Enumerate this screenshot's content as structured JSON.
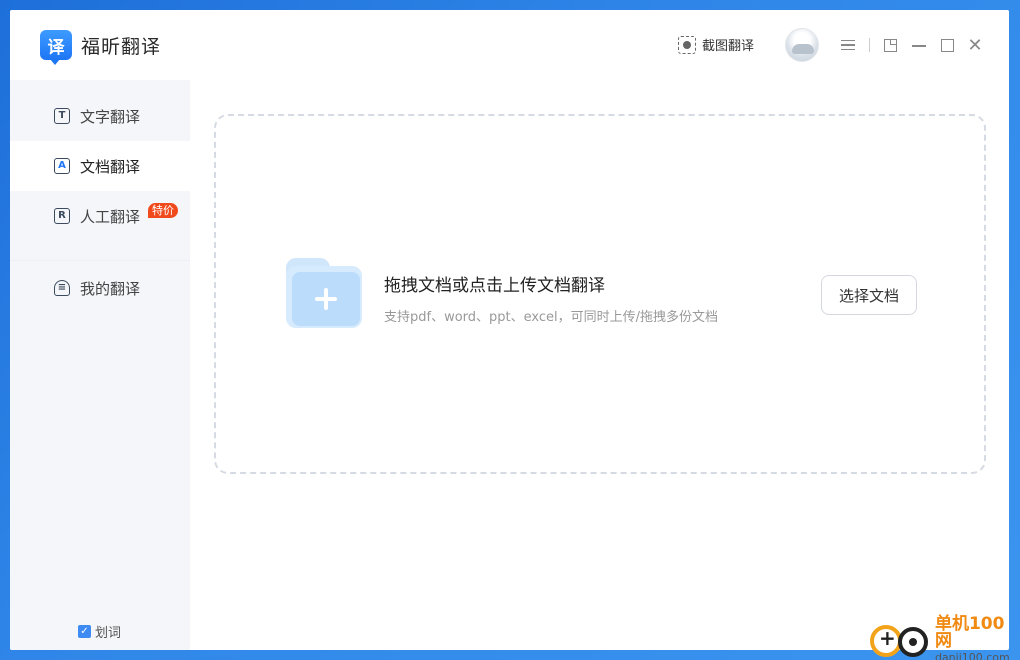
{
  "app": {
    "logo_glyph": "译",
    "name": "福昕翻译"
  },
  "titlebar": {
    "screenshot_translate": "截图翻译",
    "close_glyph": "✕"
  },
  "sidebar": {
    "items": [
      {
        "label": "文字翻译",
        "icon": "text-translate-icon",
        "icon_glyph": "T"
      },
      {
        "label": "文档翻译",
        "icon": "document-translate-icon",
        "icon_glyph": "A"
      },
      {
        "label": "人工翻译",
        "icon": "human-translate-icon",
        "icon_glyph": "R",
        "badge": "特价"
      },
      {
        "label": "我的翻译",
        "icon": "my-translations-icon",
        "icon_glyph": "≡"
      }
    ],
    "huaci": {
      "label": "划词",
      "checked": true,
      "check_glyph": "✓"
    }
  },
  "main": {
    "dropzone_title": "拖拽文档或点击上传文档翻译",
    "dropzone_subtitle": "支持pdf、word、ppt、excel，可同时上传/拖拽多份文档",
    "choose_button": "选择文档"
  },
  "watermark": {
    "cn": "单机100网",
    "en": "danji100.com"
  },
  "colors": {
    "accent": "#1f76f5",
    "badge": "#f04a1c",
    "folder": "#bcdcfb"
  }
}
